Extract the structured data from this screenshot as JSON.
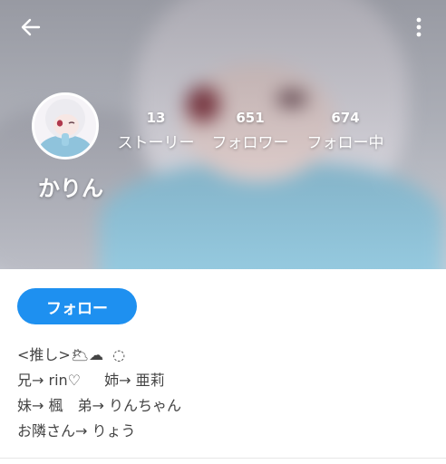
{
  "header": {
    "back_icon": "arrow-left-icon",
    "more_icon": "more-vertical-icon"
  },
  "profile": {
    "name": "かりん",
    "avatar": "avatar-image",
    "stats": [
      {
        "value": "13",
        "label": "ストーリー"
      },
      {
        "value": "651",
        "label": "フォロワー"
      },
      {
        "value": "674",
        "label": "フォロー中"
      }
    ]
  },
  "actions": {
    "follow_label": "フォロー"
  },
  "bio": {
    "lines": [
      "<推し>🌥☁︎︎︎︎︎︎ ︎︎︎︎︎︎ ◌",
      "兄→ rin♡　  姉→ 亜莉",
      "妹→ 楓　弟→ りんちゃん",
      "お隣さん→ りょう"
    ]
  },
  "colors": {
    "accent": "#1e90f0",
    "header_text": "#ffffff"
  }
}
